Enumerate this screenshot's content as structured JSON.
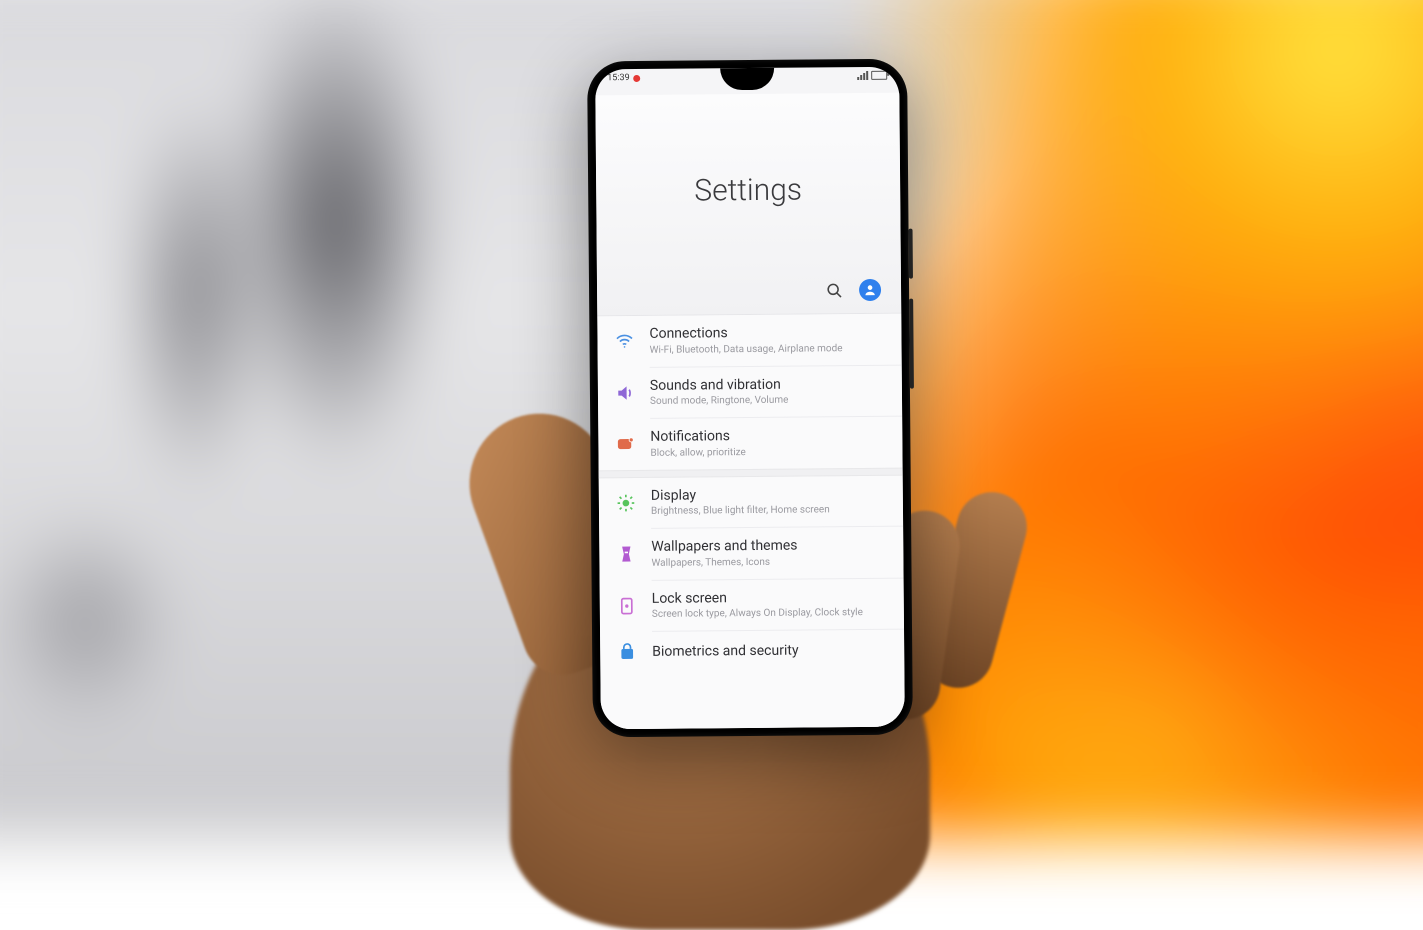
{
  "status": {
    "time": "15:39"
  },
  "header": {
    "title": "Settings"
  },
  "items": [
    {
      "icon": "wifi",
      "color": "#4a90e2",
      "title": "Connections",
      "sub": "Wi-Fi, Bluetooth, Data usage, Airplane mode"
    },
    {
      "icon": "sound",
      "color": "#8e67d6",
      "title": "Sounds and vibration",
      "sub": "Sound mode, Ringtone, Volume"
    },
    {
      "icon": "notif",
      "color": "#e06a4a",
      "title": "Notifications",
      "sub": "Block, allow, prioritize"
    },
    {
      "icon": "display",
      "color": "#57c45c",
      "title": "Display",
      "sub": "Brightness, Blue light filter, Home screen"
    },
    {
      "icon": "wallpaper",
      "color": "#b25ad1",
      "title": "Wallpapers and themes",
      "sub": "Wallpapers, Themes, Icons"
    },
    {
      "icon": "lock",
      "color": "#c96fd4",
      "title": "Lock screen",
      "sub": "Screen lock type, Always On Display, Clock style"
    },
    {
      "icon": "bio",
      "color": "#3a8ee0",
      "title": "Biometrics and security",
      "sub": ""
    }
  ],
  "groupBreaks": [
    3
  ]
}
